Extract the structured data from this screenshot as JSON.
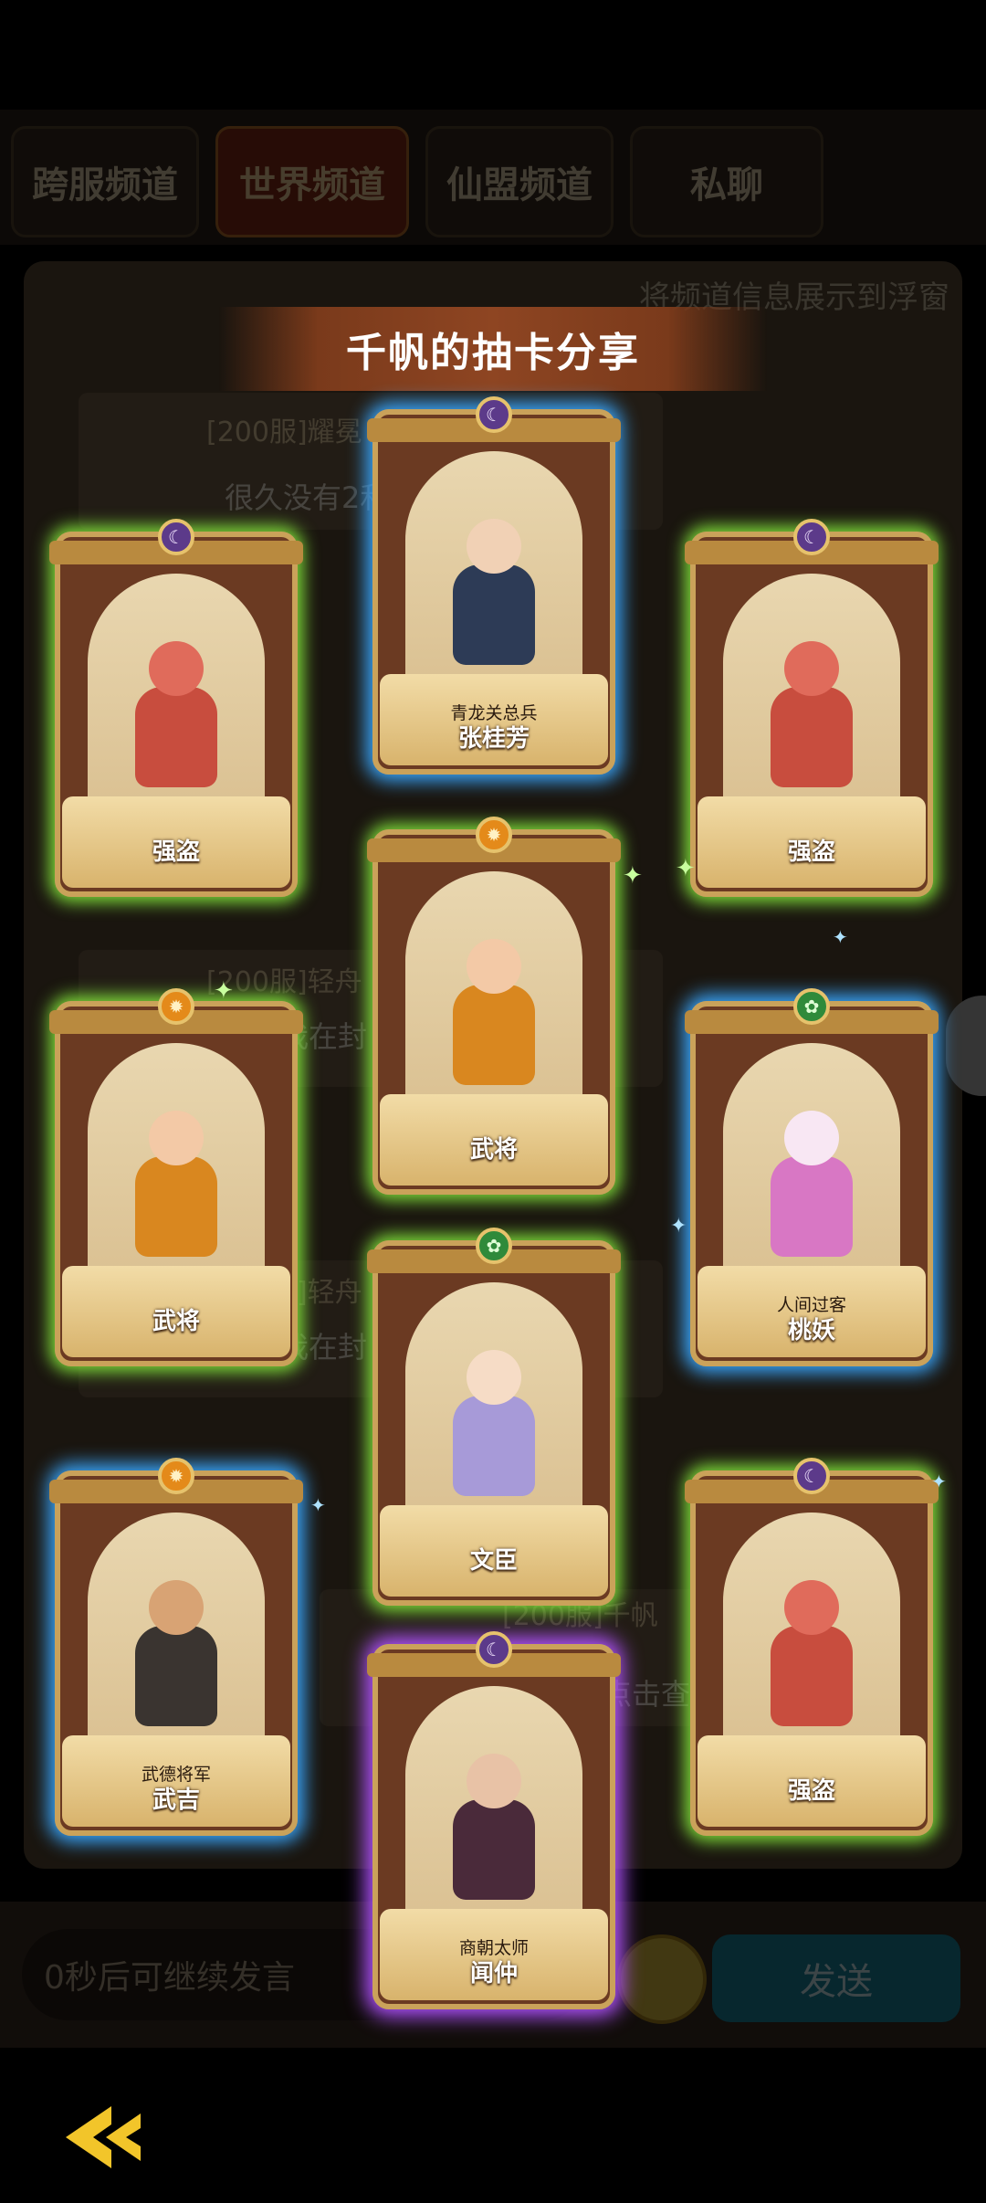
{
  "background": {
    "tabs": [
      "跨服频道",
      "世界频道",
      "仙盟频道",
      "私聊"
    ],
    "active_tab": "世界频道",
    "float_option_label": "将频道信息展示到浮窗",
    "chat_messages": [
      {
        "name": "[200服]耀冕",
        "text": "很久没有2和"
      },
      {
        "name": "[200服]轻舟",
        "text": "我在封"
      },
      {
        "name": "[200服]轻舟",
        "text": "我在封"
      },
      {
        "name": "[200服]千帆",
        "text": "点击查看"
      }
    ],
    "input_placeholder": "0秒后可继续发言",
    "send_label": "发送"
  },
  "share": {
    "title": "千帆的抽卡分享"
  },
  "cards": [
    {
      "subtitle": "",
      "name": "强盗",
      "rarity": "green",
      "badge": "moon"
    },
    {
      "subtitle": "青龙关总兵",
      "name": "张桂芳",
      "rarity": "blue",
      "badge": "moon"
    },
    {
      "subtitle": "",
      "name": "强盗",
      "rarity": "green",
      "badge": "moon"
    },
    {
      "subtitle": "",
      "name": "武将",
      "rarity": "green",
      "badge": "sun"
    },
    {
      "subtitle": "",
      "name": "武将",
      "rarity": "green",
      "badge": "sun"
    },
    {
      "subtitle": "人间过客",
      "name": "桃妖",
      "rarity": "blue",
      "badge": "leaf"
    },
    {
      "subtitle": "",
      "name": "文臣",
      "rarity": "green",
      "badge": "leaf"
    },
    {
      "subtitle": "武德将军",
      "name": "武吉",
      "rarity": "blue",
      "badge": "sun"
    },
    {
      "subtitle": "",
      "name": "强盗",
      "rarity": "green",
      "badge": "moon"
    },
    {
      "subtitle": "商朝太师",
      "name": "闻仲",
      "rarity": "purple",
      "badge": "moon"
    }
  ],
  "colors": {
    "green_glow": "#7fdc3a",
    "blue_glow": "#3aa8ff",
    "purple_glow": "#b253ff",
    "banner": "#8e4522"
  }
}
